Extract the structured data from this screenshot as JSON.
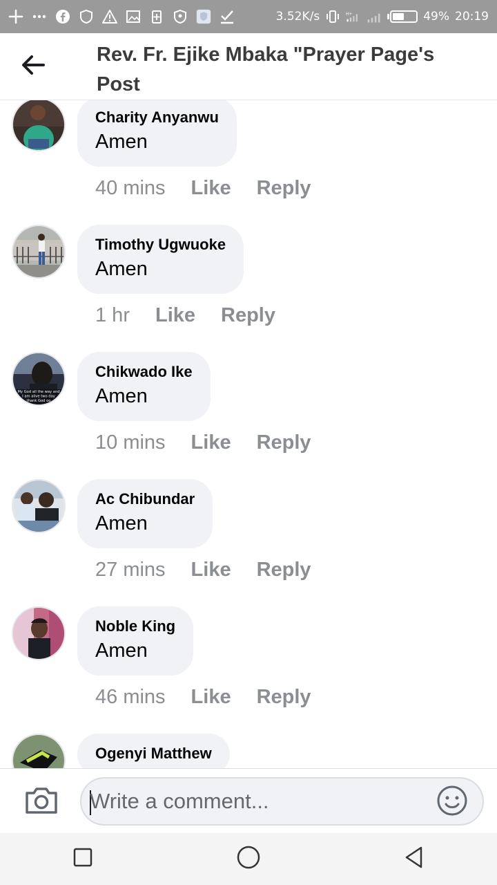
{
  "status_bar": {
    "network_speed": "3.52K/s",
    "battery_percent": "49%",
    "battery_level": 0.49,
    "time": "20:19",
    "icons_left": [
      "plus-icon",
      "more-icon",
      "facebook-icon",
      "shield-icon",
      "warning-icon",
      "image-icon",
      "battery-saver-icon",
      "shield-icon",
      "app-icon",
      "check-icon"
    ],
    "icons_right": [
      "vibrate-icon",
      "signal-icon",
      "signal-icon",
      "battery-icon"
    ]
  },
  "header": {
    "title": "Rev. Fr. Ejike Mbaka \"Prayer Page's Post",
    "back_icon": "arrow-left-icon"
  },
  "comments": [
    {
      "name": "Charity Anyanwu",
      "text": "Amen",
      "time": "40 mins",
      "like_label": "Like",
      "reply_label": "Reply",
      "avatar_color": "#2fa88a"
    },
    {
      "name": "Timothy Ugwuoke",
      "text": "Amen",
      "time": "1 hr",
      "like_label": "Like",
      "reply_label": "Reply",
      "avatar_color": "#8a8f8f"
    },
    {
      "name": "Chikwado Ike",
      "text": "Amen",
      "time": "10 mins",
      "like_label": "Like",
      "reply_label": "Reply",
      "avatar_color": "#2b3140",
      "avatar_caption_1": "My God all the way and",
      "avatar_caption_2": "I am alive two day",
      "avatar_caption_3": "thank God oo"
    },
    {
      "name": "Ac Chibundar",
      "text": "Amen",
      "time": "27 mins",
      "like_label": "Like",
      "reply_label": "Reply",
      "avatar_color": "#6d8aa8"
    },
    {
      "name": "Noble King",
      "text": "Amen",
      "time": "46 mins",
      "like_label": "Like",
      "reply_label": "Reply",
      "avatar_color": "#c56a86"
    },
    {
      "name": "Ogenyi Matthew",
      "text": "",
      "time": "",
      "like_label": "",
      "reply_label": "",
      "avatar_color": "#5f7a52"
    }
  ],
  "composer": {
    "placeholder": "Write a comment...",
    "camera_icon": "camera-icon",
    "emoji_icon": "emoji-icon"
  },
  "nav": {
    "icons": [
      "recents-square-icon",
      "home-circle-icon",
      "back-triangle-icon"
    ]
  },
  "colors": {
    "status_bar_bg": "#9a9a9a",
    "bubble_bg": "#f0f2f5",
    "meta_text": "#8a8d91"
  }
}
